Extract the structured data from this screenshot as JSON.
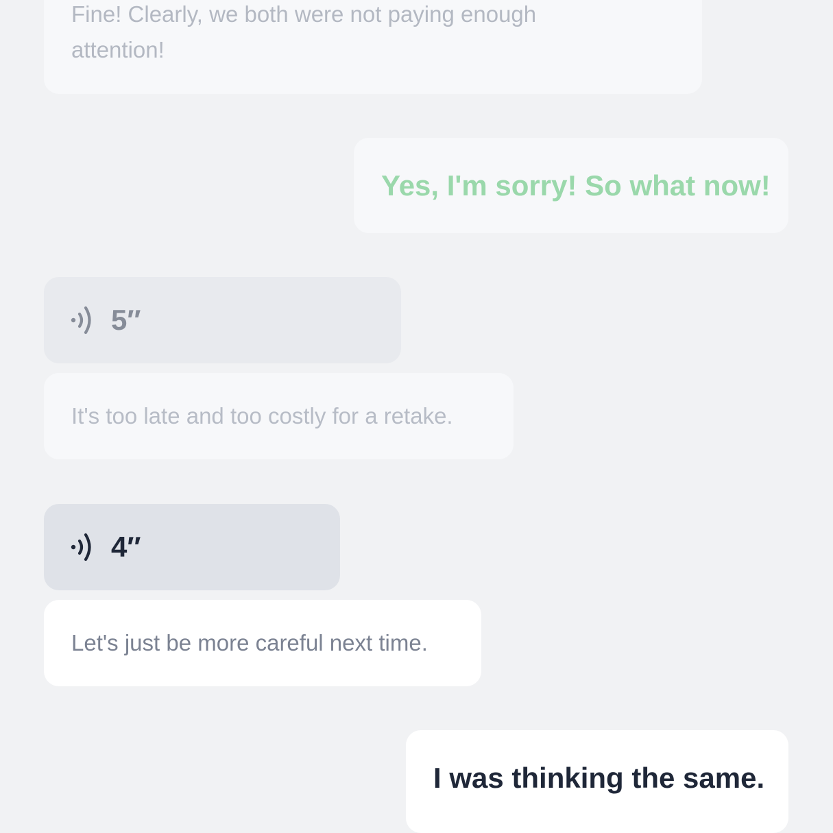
{
  "messages": [
    {
      "type": "text",
      "direction": "incoming",
      "text": "Fine! Clearly, we both were not paying enough attention!"
    },
    {
      "type": "text",
      "direction": "outgoing",
      "text": "Yes, I'm sorry! So what now!",
      "color": "#9ad8ab"
    },
    {
      "type": "voice",
      "direction": "incoming",
      "duration": "5″",
      "icon": "audio-wave-icon"
    },
    {
      "type": "text",
      "direction": "incoming",
      "text": "It's too late and too costly for a retake."
    },
    {
      "type": "voice",
      "direction": "incoming",
      "duration": "4″",
      "icon": "audio-wave-icon"
    },
    {
      "type": "text",
      "direction": "incoming",
      "text": "Let's just be more careful next time."
    },
    {
      "type": "text",
      "direction": "outgoing",
      "text": "I was thinking the same."
    }
  ]
}
